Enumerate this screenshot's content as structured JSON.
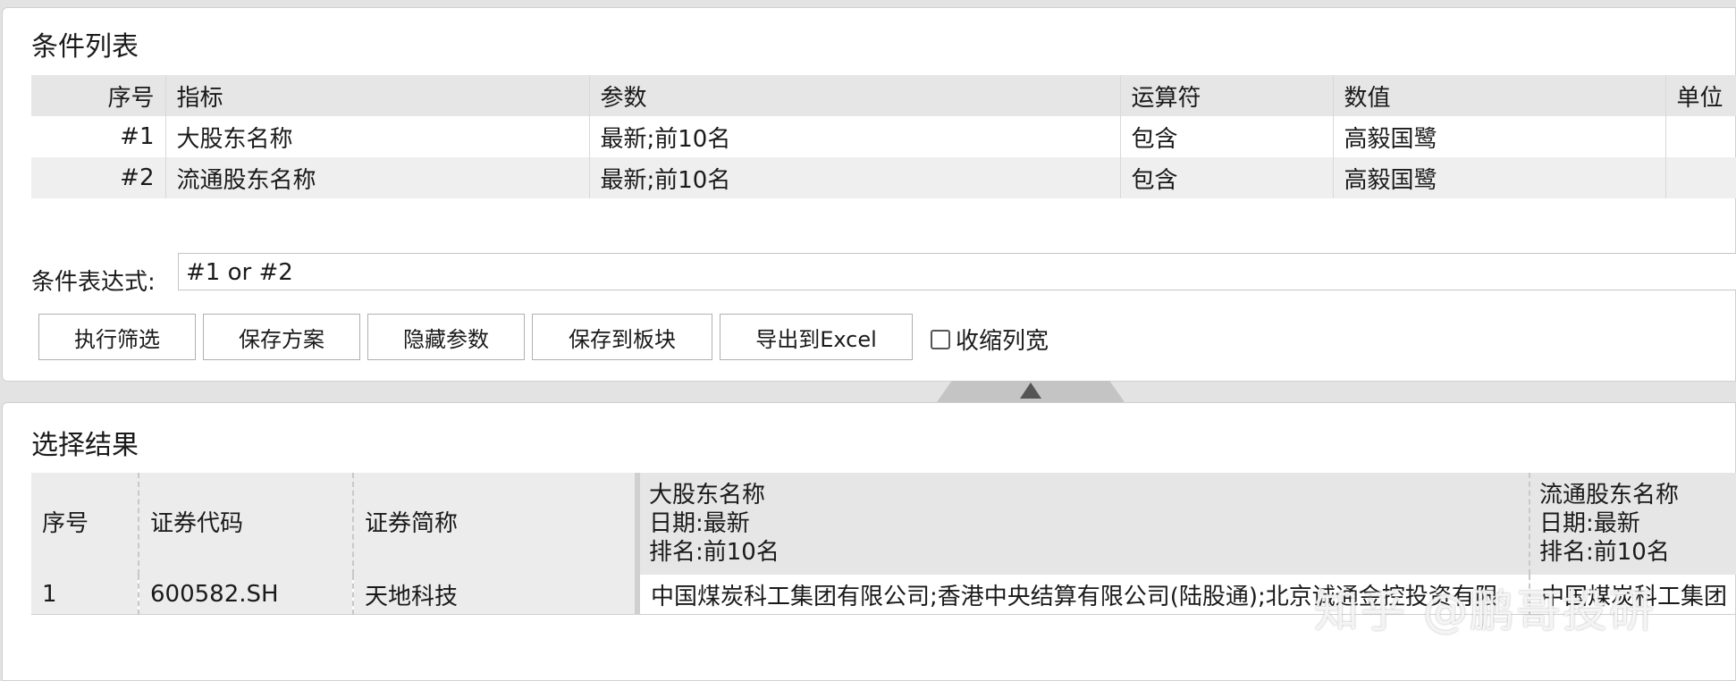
{
  "conditions_section": {
    "title": "条件列表",
    "headers": [
      "序号",
      "指标",
      "参数",
      "运算符",
      "数值",
      "单位"
    ],
    "rows": [
      [
        "#1",
        "大股东名称",
        "最新;前10名",
        "包含",
        "高毅国鹭",
        ""
      ],
      [
        "#2",
        "流通股东名称",
        "最新;前10名",
        "包含",
        "高毅国鹭",
        ""
      ]
    ],
    "expression_label": "条件表达式:",
    "expression_value": "#1 or #2"
  },
  "buttons": {
    "execute": "执行筛选",
    "save_plan": "保存方案",
    "hide_params": "隐藏参数",
    "save_to_block": "保存到板块",
    "export_excel": "导出到Excel"
  },
  "shrink_checkbox": {
    "label": "收缩列宽",
    "checked": false
  },
  "results_section": {
    "title": "选择结果",
    "headers": {
      "index": "序号",
      "code": "证券代码",
      "name": "证券简称",
      "col4": {
        "line1": "大股东名称",
        "line2": "日期:最新",
        "line3": "排名:前10名"
      },
      "col5": {
        "line1": "流通股东名称",
        "line2": "日期:最新",
        "line3": "排名:前10名"
      }
    },
    "rows": [
      [
        "1",
        "600582.SH",
        "天地科技",
        "中国煤炭科工集团有限公司;香港中央结算有限公司(陆股通);北京诚通金控投资有限",
        "中国煤炭科工集团"
      ]
    ]
  },
  "watermark": "知乎 @鹏哥投研"
}
